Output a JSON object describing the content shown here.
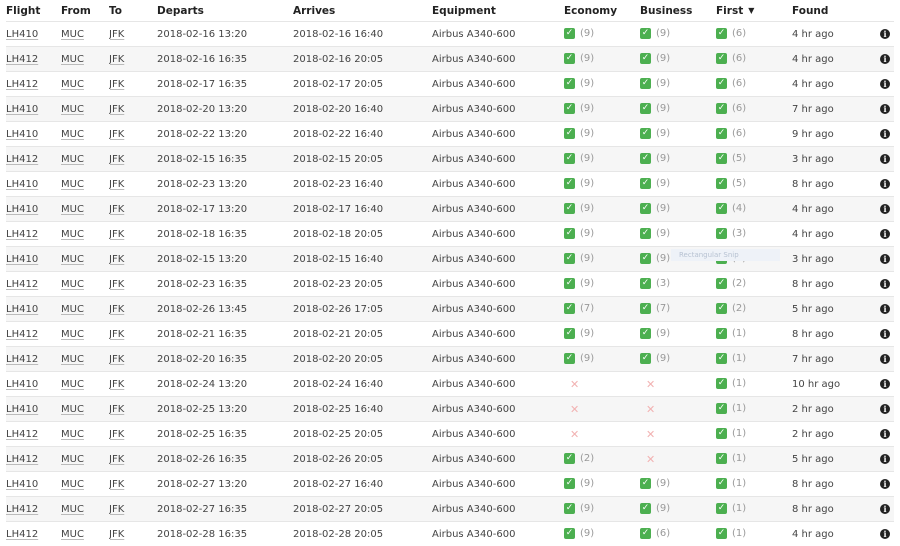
{
  "columns": [
    "Flight",
    "From",
    "To",
    "Departs",
    "Arrives",
    "Equipment",
    "Economy",
    "Business",
    "First",
    "Found"
  ],
  "sort_indicator": "▼",
  "tooltip": "Rectangular Snip",
  "rows": [
    {
      "flight": "LH410",
      "from": "MUC",
      "to": "JFK",
      "departs": "2018-02-16 13:20",
      "arrives": "2018-02-16 16:40",
      "equipment": "Airbus A340-600",
      "economy": "(9)",
      "business": "(9)",
      "first": "(6)",
      "found": "4 hr ago"
    },
    {
      "flight": "LH412",
      "from": "MUC",
      "to": "JFK",
      "departs": "2018-02-16 16:35",
      "arrives": "2018-02-16 20:05",
      "equipment": "Airbus A340-600",
      "economy": "(9)",
      "business": "(9)",
      "first": "(6)",
      "found": "4 hr ago"
    },
    {
      "flight": "LH412",
      "from": "MUC",
      "to": "JFK",
      "departs": "2018-02-17 16:35",
      "arrives": "2018-02-17 20:05",
      "equipment": "Airbus A340-600",
      "economy": "(9)",
      "business": "(9)",
      "first": "(6)",
      "found": "4 hr ago"
    },
    {
      "flight": "LH410",
      "from": "MUC",
      "to": "JFK",
      "departs": "2018-02-20 13:20",
      "arrives": "2018-02-20 16:40",
      "equipment": "Airbus A340-600",
      "economy": "(9)",
      "business": "(9)",
      "first": "(6)",
      "found": "7 hr ago"
    },
    {
      "flight": "LH410",
      "from": "MUC",
      "to": "JFK",
      "departs": "2018-02-22 13:20",
      "arrives": "2018-02-22 16:40",
      "equipment": "Airbus A340-600",
      "economy": "(9)",
      "business": "(9)",
      "first": "(6)",
      "found": "9 hr ago"
    },
    {
      "flight": "LH412",
      "from": "MUC",
      "to": "JFK",
      "departs": "2018-02-15 16:35",
      "arrives": "2018-02-15 20:05",
      "equipment": "Airbus A340-600",
      "economy": "(9)",
      "business": "(9)",
      "first": "(5)",
      "found": "3 hr ago"
    },
    {
      "flight": "LH410",
      "from": "MUC",
      "to": "JFK",
      "departs": "2018-02-23 13:20",
      "arrives": "2018-02-23 16:40",
      "equipment": "Airbus A340-600",
      "economy": "(9)",
      "business": "(9)",
      "first": "(5)",
      "found": "8 hr ago"
    },
    {
      "flight": "LH410",
      "from": "MUC",
      "to": "JFK",
      "departs": "2018-02-17 13:20",
      "arrives": "2018-02-17 16:40",
      "equipment": "Airbus A340-600",
      "economy": "(9)",
      "business": "(9)",
      "first": "(4)",
      "found": "4 hr ago"
    },
    {
      "flight": "LH412",
      "from": "MUC",
      "to": "JFK",
      "departs": "2018-02-18 16:35",
      "arrives": "2018-02-18 20:05",
      "equipment": "Airbus A340-600",
      "economy": "(9)",
      "business": "(9)",
      "first": "(3)",
      "found": "4 hr ago"
    },
    {
      "flight": "LH410",
      "from": "MUC",
      "to": "JFK",
      "departs": "2018-02-15 13:20",
      "arrives": "2018-02-15 16:40",
      "equipment": "Airbus A340-600",
      "economy": "(9)",
      "business": "(9)",
      "first": "(2)",
      "found": "3 hr ago"
    },
    {
      "flight": "LH412",
      "from": "MUC",
      "to": "JFK",
      "departs": "2018-02-23 16:35",
      "arrives": "2018-02-23 20:05",
      "equipment": "Airbus A340-600",
      "economy": "(9)",
      "business": "(3)",
      "first": "(2)",
      "found": "8 hr ago"
    },
    {
      "flight": "LH410",
      "from": "MUC",
      "to": "JFK",
      "departs": "2018-02-26 13:45",
      "arrives": "2018-02-26 17:05",
      "equipment": "Airbus A340-600",
      "economy": "(7)",
      "business": "(7)",
      "first": "(2)",
      "found": "5 hr ago"
    },
    {
      "flight": "LH412",
      "from": "MUC",
      "to": "JFK",
      "departs": "2018-02-21 16:35",
      "arrives": "2018-02-21 20:05",
      "equipment": "Airbus A340-600",
      "economy": "(9)",
      "business": "(9)",
      "first": "(1)",
      "found": "8 hr ago"
    },
    {
      "flight": "LH412",
      "from": "MUC",
      "to": "JFK",
      "departs": "2018-02-20 16:35",
      "arrives": "2018-02-20 20:05",
      "equipment": "Airbus A340-600",
      "economy": "(9)",
      "business": "(9)",
      "first": "(1)",
      "found": "7 hr ago"
    },
    {
      "flight": "LH410",
      "from": "MUC",
      "to": "JFK",
      "departs": "2018-02-24 13:20",
      "arrives": "2018-02-24 16:40",
      "equipment": "Airbus A340-600",
      "economy": null,
      "business": null,
      "first": "(1)",
      "found": "10 hr ago"
    },
    {
      "flight": "LH410",
      "from": "MUC",
      "to": "JFK",
      "departs": "2018-02-25 13:20",
      "arrives": "2018-02-25 16:40",
      "equipment": "Airbus A340-600",
      "economy": null,
      "business": null,
      "first": "(1)",
      "found": "2 hr ago"
    },
    {
      "flight": "LH412",
      "from": "MUC",
      "to": "JFK",
      "departs": "2018-02-25 16:35",
      "arrives": "2018-02-25 20:05",
      "equipment": "Airbus A340-600",
      "economy": null,
      "business": null,
      "first": "(1)",
      "found": "2 hr ago"
    },
    {
      "flight": "LH412",
      "from": "MUC",
      "to": "JFK",
      "departs": "2018-02-26 16:35",
      "arrives": "2018-02-26 20:05",
      "equipment": "Airbus A340-600",
      "economy": "(2)",
      "business": null,
      "first": "(1)",
      "found": "5 hr ago"
    },
    {
      "flight": "LH410",
      "from": "MUC",
      "to": "JFK",
      "departs": "2018-02-27 13:20",
      "arrives": "2018-02-27 16:40",
      "equipment": "Airbus A340-600",
      "economy": "(9)",
      "business": "(9)",
      "first": "(1)",
      "found": "8 hr ago"
    },
    {
      "flight": "LH412",
      "from": "MUC",
      "to": "JFK",
      "departs": "2018-02-27 16:35",
      "arrives": "2018-02-27 20:05",
      "equipment": "Airbus A340-600",
      "economy": "(9)",
      "business": "(9)",
      "first": "(1)",
      "found": "8 hr ago"
    },
    {
      "flight": "LH412",
      "from": "MUC",
      "to": "JFK",
      "departs": "2018-02-28 16:35",
      "arrives": "2018-02-28 20:05",
      "equipment": "Airbus A340-600",
      "economy": "(9)",
      "business": "(6)",
      "first": "(1)",
      "found": "4 hr ago"
    }
  ]
}
